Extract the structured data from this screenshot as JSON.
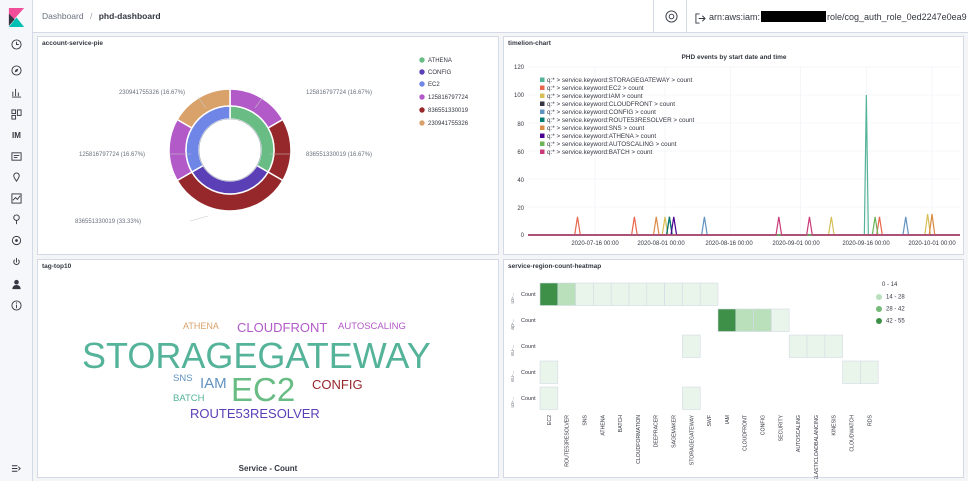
{
  "breadcrumb": [
    "Dashboard",
    "phd-dashboard"
  ],
  "user": {
    "arn_prefix": "arn:aws:iam:",
    "arn_suffix": "role/cog_auth_role_0ed2247e0ea9"
  },
  "nav_icons": [
    "clock-icon",
    "compass-icon",
    "visualize-icon",
    "dashboard-icon",
    "IM",
    "canvas-icon",
    "maps-icon",
    "ml-icon",
    "graph-icon",
    "devtools-icon",
    "monitoring-icon",
    "index-patterns-icon",
    "security-icon",
    "info-icon",
    "dock-icon"
  ],
  "nav_im_label": "IM",
  "panels": {
    "pie": {
      "title": "account-service-pie",
      "legend": [
        "ATHENA",
        "CONFIG",
        "EC2",
        "125816797724",
        "836551330019",
        "230941755326"
      ],
      "callouts": [
        "230941755326 (16.67%)",
        "125816797724 (16.67%)",
        "125816797724 (16.67%)",
        "836551330019 (16.67%)",
        "836551330019 (33.33%)"
      ],
      "colors": {
        "ATHENA": "#68bc84",
        "CONFIG": "#5b3fb7",
        "EC2": "#7086e6",
        "125816797724": "#b35ac9",
        "836551330019": "#96282b",
        "230941755326": "#d9a26a"
      }
    },
    "timeline": {
      "title": "timelion-chart",
      "chart_title": "PHD events by start date and time",
      "y_ticks": [
        "120",
        "100",
        "80",
        "60",
        "40",
        "20",
        "0"
      ],
      "x_ticks": [
        "2020-07-16 00:00",
        "2020-08-01 00:00",
        "2020-08-16 00:00",
        "2020-09-01 00:00",
        "2020-09-16 00:00",
        "2020-10-01 00:00"
      ]
    },
    "tags": {
      "title": "tag-top10",
      "footer": "Service - Count",
      "words": [
        "ATHENA",
        "CLOUDFRONT",
        "AUTOSCALING",
        "STORAGEGATEWAY",
        "SNS",
        "IAM",
        "EC2",
        "CONFIG",
        "BATCH",
        "ROUTE53RESOLVER"
      ]
    },
    "heatmap": {
      "title": "service-region-count-heatmap",
      "row_label": "Count",
      "row_groups": [
        "us-...",
        "ap-...",
        "eu-...",
        "eu-...",
        "us-..."
      ],
      "columns": [
        "EC2",
        "ROUTE53RESOLVER",
        "SNS",
        "ATHENA",
        "BATCH",
        "CLOUDFORMATION",
        "DEEPRACER",
        "SAGEMAKER",
        "STORAGEGATEWAY",
        "SWF",
        "IAM",
        "CLOUDFRONT",
        "CONFIG",
        "SECURITY",
        "AUTOSCALING",
        "ELASTICLOADBALANCING",
        "KINESIS",
        "CLOUDWATCH",
        "RDS"
      ],
      "legend": [
        "0 - 14",
        "14 - 28",
        "28 - 42",
        "42 - 55"
      ],
      "legend_colors": [
        "#e9f5ea",
        "#b9e0bb",
        "#74bb7a",
        "#3e8f47"
      ]
    }
  },
  "chart_data": [
    {
      "type": "pie",
      "title": "",
      "inner_ring": [
        {
          "label": "ATHENA",
          "value": 1
        },
        {
          "label": "CONFIG",
          "value": 1
        },
        {
          "label": "EC2",
          "value": 1
        }
      ],
      "outer_ring": [
        {
          "label": "ATHENA",
          "value": 33.33,
          "share_label": "125816797724 (16.67%)"
        },
        {
          "label": "CONFIG",
          "value": 33.33,
          "share_label": "836551330019 (16.67%) / 836551330019 (33.33%)"
        },
        {
          "label": "EC2",
          "value": 33.33,
          "share_label": "125816797724 (16.67%) / 230941755326 (16.67%)"
        }
      ]
    },
    {
      "type": "line",
      "title": "PHD events by start date and time",
      "xlabel": "",
      "ylabel": "",
      "ylim": [
        0,
        120
      ],
      "x": [
        "2020-07-16",
        "2020-08-01",
        "2020-08-16",
        "2020-09-01",
        "2020-09-16",
        "2020-10-01"
      ],
      "series": [
        {
          "name": "q:* > service.keyword:STORAGEGATEWAY > count",
          "color": "#54b399",
          "spikes": [
            [
              "2020-09-16",
              100
            ]
          ]
        },
        {
          "name": "q:* > service.keyword:EC2 > count",
          "color": "#e7664c",
          "spikes": [
            [
              "2020-07-12",
              13
            ],
            [
              "2020-07-25",
              13
            ],
            [
              "2020-09-19",
              13
            ]
          ]
        },
        {
          "name": "q:* > service.keyword:IAM > count",
          "color": "#d6bf57",
          "spikes": [
            [
              "2020-08-01",
              13
            ],
            [
              "2020-09-08",
              13
            ],
            [
              "2020-09-30",
              15
            ]
          ]
        },
        {
          "name": "q:* > service.keyword:CLOUDFRONT > count",
          "color": "#343741",
          "spikes": [
            [
              "2020-08-02",
              13
            ]
          ]
        },
        {
          "name": "q:* > service.keyword:CONFIG > count",
          "color": "#6092c0",
          "spikes": [
            [
              "2020-08-10",
              13
            ],
            [
              "2020-09-25",
              13
            ]
          ]
        },
        {
          "name": "q:* > service.keyword:ROUTE53RESOLVER > count",
          "color": "#017d73",
          "spikes": [
            [
              "2020-08-02",
              13
            ]
          ]
        },
        {
          "name": "q:* > service.keyword:SNS > count",
          "color": "#da8b45",
          "spikes": [
            [
              "2020-07-30",
              13
            ],
            [
              "2020-10-01",
              15
            ]
          ]
        },
        {
          "name": "q:* > service.keyword:ATHENA > count",
          "color": "#490092",
          "spikes": [
            [
              "2020-08-03",
              13
            ]
          ]
        },
        {
          "name": "q:* > service.keyword:AUTOSCALING > count",
          "color": "#6db35a",
          "spikes": [
            [
              "2020-09-18",
              13
            ]
          ]
        },
        {
          "name": "q:* > service.keyword:BATCH > count",
          "color": "#ca3977",
          "spikes": [
            [
              "2020-08-27",
              13
            ],
            [
              "2020-09-03",
              13
            ]
          ]
        }
      ]
    },
    {
      "type": "heatmap",
      "title": "service-region-count-heatmap",
      "rows": [
        "us-...",
        "ap-...",
        "eu-...",
        "eu-...",
        "us-..."
      ],
      "columns": [
        "EC2",
        "ROUTE53RESOLVER",
        "SNS",
        "ATHENA",
        "BATCH",
        "CLOUDFORMATION",
        "DEEPRACER",
        "SAGEMAKER",
        "STORAGEGATEWAY",
        "SWF",
        "IAM",
        "CLOUDFRONT",
        "CONFIG",
        "SECURITY",
        "AUTOSCALING",
        "ELASTICLOADBALANCING",
        "KINESIS",
        "CLOUDWATCH",
        "RDS"
      ],
      "cells": [
        [
          0,
          0,
          55
        ],
        [
          0,
          1,
          20
        ],
        [
          0,
          2,
          5
        ],
        [
          0,
          3,
          5
        ],
        [
          0,
          4,
          5
        ],
        [
          0,
          5,
          5
        ],
        [
          0,
          6,
          5
        ],
        [
          0,
          7,
          5
        ],
        [
          0,
          8,
          5
        ],
        [
          0,
          9,
          5
        ],
        [
          1,
          10,
          45
        ],
        [
          1,
          11,
          22
        ],
        [
          1,
          12,
          20
        ],
        [
          1,
          13,
          5
        ],
        [
          2,
          8,
          3
        ],
        [
          2,
          14,
          3
        ],
        [
          2,
          15,
          3
        ],
        [
          2,
          16,
          3
        ],
        [
          3,
          0,
          3
        ],
        [
          3,
          17,
          3
        ],
        [
          3,
          18,
          3
        ],
        [
          4,
          0,
          3
        ],
        [
          4,
          8,
          3
        ]
      ],
      "legend": [
        "0 - 14",
        "14 - 28",
        "28 - 42",
        "42 - 55"
      ]
    }
  ]
}
